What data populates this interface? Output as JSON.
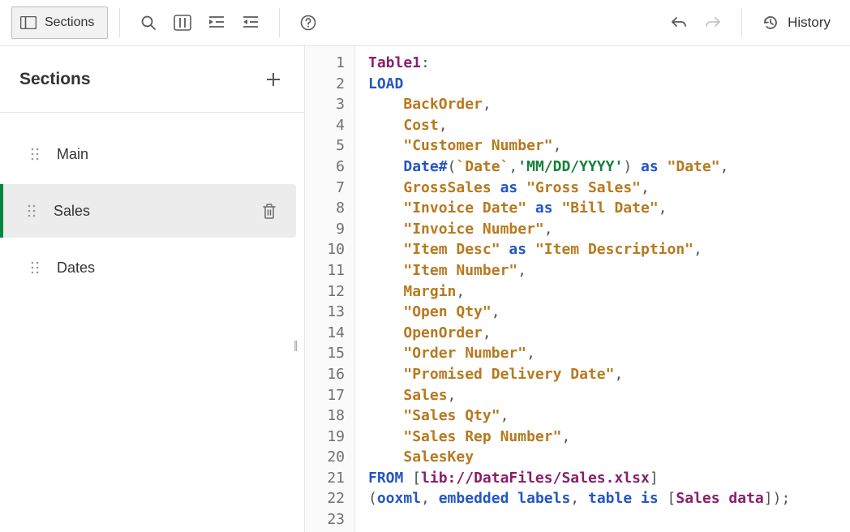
{
  "toolbar": {
    "sections_label": "Sections",
    "history_label": "History"
  },
  "sidebar": {
    "title": "Sections",
    "items": [
      {
        "label": "Main",
        "active": false
      },
      {
        "label": "Sales",
        "active": true
      },
      {
        "label": "Dates",
        "active": false
      }
    ]
  },
  "editor": {
    "lines": [
      [
        {
          "t": "label",
          "v": "Table1"
        },
        {
          "t": "punct",
          "v": ":"
        }
      ],
      [
        {
          "t": "kw",
          "v": "LOAD"
        }
      ],
      [
        {
          "t": "pad",
          "v": "    "
        },
        {
          "t": "field",
          "v": "BackOrder"
        },
        {
          "t": "punct",
          "v": ","
        }
      ],
      [
        {
          "t": "pad",
          "v": "    "
        },
        {
          "t": "field",
          "v": "Cost"
        },
        {
          "t": "punct",
          "v": ","
        }
      ],
      [
        {
          "t": "pad",
          "v": "    "
        },
        {
          "t": "str",
          "v": "\"Customer Number\""
        },
        {
          "t": "punct",
          "v": ","
        }
      ],
      [
        {
          "t": "pad",
          "v": "    "
        },
        {
          "t": "func",
          "v": "Date#"
        },
        {
          "t": "punct",
          "v": "("
        },
        {
          "t": "id",
          "v": "`Date`"
        },
        {
          "t": "punct",
          "v": ","
        },
        {
          "t": "lit",
          "v": "'MM/DD/YYYY'"
        },
        {
          "t": "punct",
          "v": ") "
        },
        {
          "t": "kw",
          "v": "as"
        },
        {
          "t": "punct",
          "v": " "
        },
        {
          "t": "str",
          "v": "\"Date\""
        },
        {
          "t": "punct",
          "v": ","
        }
      ],
      [
        {
          "t": "pad",
          "v": "    "
        },
        {
          "t": "field",
          "v": "GrossSales"
        },
        {
          "t": "punct",
          "v": " "
        },
        {
          "t": "kw",
          "v": "as"
        },
        {
          "t": "punct",
          "v": " "
        },
        {
          "t": "str",
          "v": "\"Gross Sales\""
        },
        {
          "t": "punct",
          "v": ","
        }
      ],
      [
        {
          "t": "pad",
          "v": "    "
        },
        {
          "t": "str",
          "v": "\"Invoice Date\""
        },
        {
          "t": "punct",
          "v": " "
        },
        {
          "t": "kw",
          "v": "as"
        },
        {
          "t": "punct",
          "v": " "
        },
        {
          "t": "str",
          "v": "\"Bill Date\""
        },
        {
          "t": "punct",
          "v": ","
        }
      ],
      [
        {
          "t": "pad",
          "v": "    "
        },
        {
          "t": "str",
          "v": "\"Invoice Number\""
        },
        {
          "t": "punct",
          "v": ","
        }
      ],
      [
        {
          "t": "pad",
          "v": "    "
        },
        {
          "t": "str",
          "v": "\"Item Desc\""
        },
        {
          "t": "punct",
          "v": " "
        },
        {
          "t": "kw",
          "v": "as"
        },
        {
          "t": "punct",
          "v": " "
        },
        {
          "t": "str",
          "v": "\"Item Description\""
        },
        {
          "t": "punct",
          "v": ","
        }
      ],
      [
        {
          "t": "pad",
          "v": "    "
        },
        {
          "t": "str",
          "v": "\"Item Number\""
        },
        {
          "t": "punct",
          "v": ","
        }
      ],
      [
        {
          "t": "pad",
          "v": "    "
        },
        {
          "t": "field",
          "v": "Margin"
        },
        {
          "t": "punct",
          "v": ","
        }
      ],
      [
        {
          "t": "pad",
          "v": "    "
        },
        {
          "t": "str",
          "v": "\"Open Qty\""
        },
        {
          "t": "punct",
          "v": ","
        }
      ],
      [
        {
          "t": "pad",
          "v": "    "
        },
        {
          "t": "field",
          "v": "OpenOrder"
        },
        {
          "t": "punct",
          "v": ","
        }
      ],
      [
        {
          "t": "pad",
          "v": "    "
        },
        {
          "t": "str",
          "v": "\"Order Number\""
        },
        {
          "t": "punct",
          "v": ","
        }
      ],
      [
        {
          "t": "pad",
          "v": "    "
        },
        {
          "t": "str",
          "v": "\"Promised Delivery Date\""
        },
        {
          "t": "punct",
          "v": ","
        }
      ],
      [
        {
          "t": "pad",
          "v": "    "
        },
        {
          "t": "field",
          "v": "Sales"
        },
        {
          "t": "punct",
          "v": ","
        }
      ],
      [
        {
          "t": "pad",
          "v": "    "
        },
        {
          "t": "str",
          "v": "\"Sales Qty\""
        },
        {
          "t": "punct",
          "v": ","
        }
      ],
      [
        {
          "t": "pad",
          "v": "    "
        },
        {
          "t": "str",
          "v": "\"Sales Rep Number\""
        },
        {
          "t": "punct",
          "v": ","
        }
      ],
      [
        {
          "t": "pad",
          "v": "    "
        },
        {
          "t": "field",
          "v": "SalesKey"
        }
      ],
      [
        {
          "t": "kw",
          "v": "FROM"
        },
        {
          "t": "punct",
          "v": " ["
        },
        {
          "t": "src",
          "v": "lib://DataFiles/Sales.xlsx"
        },
        {
          "t": "punct",
          "v": "]"
        }
      ],
      [
        {
          "t": "punct",
          "v": "("
        },
        {
          "t": "kw",
          "v": "ooxml"
        },
        {
          "t": "punct",
          "v": ", "
        },
        {
          "t": "kw",
          "v": "embedded"
        },
        {
          "t": "punct",
          "v": " "
        },
        {
          "t": "kw",
          "v": "labels"
        },
        {
          "t": "punct",
          "v": ", "
        },
        {
          "t": "kw",
          "v": "table"
        },
        {
          "t": "punct",
          "v": " "
        },
        {
          "t": "kw",
          "v": "is"
        },
        {
          "t": "punct",
          "v": " ["
        },
        {
          "t": "src",
          "v": "Sales data"
        },
        {
          "t": "punct",
          "v": "]);"
        }
      ],
      []
    ]
  }
}
